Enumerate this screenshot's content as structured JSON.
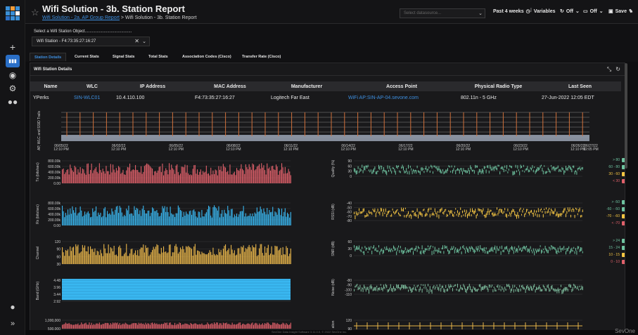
{
  "app": {
    "title": "Wifi Solution - 3b. Station Report",
    "breadcrumb_link": "Wifi Solution - 2a. AP Group Report",
    "breadcrumb_sep": " > ",
    "breadcrumb_current": "Wifi Solution - 3b. Station Report"
  },
  "toolbar": {
    "datasource_placeholder": "Select datasource...",
    "timerange": "Past 4 weeks",
    "variables": "Variables",
    "refresh": "Off",
    "display": "Off",
    "save": "Save"
  },
  "variable": {
    "label": "Select a Wifi Station Object........................................",
    "value": "Wifi Station - F4:73:35:27:16:27"
  },
  "tabs": [
    "Station Details",
    "Current Stats",
    "Signal Stats",
    "Total Stats",
    "Association Codes (Cisco)",
    "Transfer Rate (Cisco)"
  ],
  "panel": {
    "title": "Wifi Station Details"
  },
  "table": {
    "headers": [
      "Name",
      "WLC",
      "IP Address",
      "MAC Address",
      "Manufacturer",
      "Access Point",
      "Physical Radio Type",
      "Last Seen"
    ],
    "row": [
      "YPerks",
      "SIN-WLC01",
      "10.4.110.100",
      "F4:73:35:27:16:27",
      "Logitech Far East",
      "WiFi AP:SIN-AP-04.sevone.com",
      "802.11n - 5 GHz",
      "27-Jun-2022 12:05 EDT"
    ]
  },
  "timeline": {
    "ylabel": "AP, WLC and SSID Trails",
    "ticks": [
      {
        "date": "06/05/22",
        "time": "12:10 PM"
      },
      {
        "date": "06/02/22",
        "time": "12:10 PM"
      },
      {
        "date": "06/05/22",
        "time": "12:10 PM"
      },
      {
        "date": "06/08/22",
        "time": "12:10 PM"
      },
      {
        "date": "06/11/22",
        "time": "12:10 PM"
      },
      {
        "date": "06/14/22",
        "time": "12:10 PM"
      },
      {
        "date": "06/17/22",
        "time": "12:10 PM"
      },
      {
        "date": "06/20/22",
        "time": "12:10 PM"
      },
      {
        "date": "06/23/22",
        "time": "12:10 PM"
      },
      {
        "date": "06/26/22",
        "time": "12:10 PM"
      }
    ],
    "last_tick": {
      "date": "06/27/22",
      "time": "12:05 PM"
    }
  },
  "left_charts": [
    {
      "ylabel": "Tx (bits/sec)",
      "ticks": [
        "800.00k",
        "600.00k",
        "400.00k",
        "200.00k",
        "0.00"
      ],
      "color": "#e0606a",
      "kind": "bars"
    },
    {
      "ylabel": "Rx (bits/sec)",
      "ticks": [
        "800.00k",
        "600.00k",
        "400.00k",
        "200.00k",
        "0.00"
      ],
      "color": "#39b7f0",
      "kind": "bars"
    },
    {
      "ylabel": "Channel",
      "ticks": [
        "120",
        "90",
        "60",
        "30"
      ],
      "color": "#e9b64a",
      "kind": "bars"
    },
    {
      "ylabel": "Band (GHz)",
      "ticks": [
        "4.48",
        "3.96",
        "3.44",
        "2.92"
      ],
      "color": "#39b7f0",
      "kind": "fill"
    },
    {
      "ylabel": "",
      "ticks": [
        "1,000,000",
        "500,000"
      ],
      "color": "#e0606a",
      "kind": "bars"
    }
  ],
  "right_charts": [
    {
      "ylabel": "Quality (%)",
      "ticks": [
        "90",
        "60",
        "30",
        "0"
      ],
      "legend": [
        {
          "label": "> 80",
          "color": "#6ec3a0"
        },
        {
          "label": "60 - 80",
          "color": "#6ec3a0"
        },
        {
          "label": "30 - 60",
          "color": "#f4c542"
        },
        {
          "label": "< 30",
          "color": "#e0606a"
        }
      ]
    },
    {
      "ylabel": "RSSI (dB)",
      "ticks": [
        "-40",
        "-50",
        "-60",
        "-70",
        "-80"
      ],
      "legend": [
        {
          "label": "> -50",
          "color": "#6ec3a0"
        },
        {
          "label": "-60 - -50",
          "color": "#6ec3a0"
        },
        {
          "label": "-70 - -60",
          "color": "#f4c542"
        },
        {
          "label": "< -70",
          "color": "#e0606a"
        }
      ]
    },
    {
      "ylabel": "SNR (dB)",
      "ticks": [
        "60",
        "30",
        "0"
      ],
      "legend": [
        {
          "label": "> 24",
          "color": "#6ec3a0"
        },
        {
          "label": "15 - 24",
          "color": "#6ec3a0"
        },
        {
          "label": "10 - 15",
          "color": "#f4c542"
        },
        {
          "label": "0 - 10",
          "color": "#e0606a"
        }
      ]
    },
    {
      "ylabel": "Noise (dB)",
      "ticks": [
        "-80",
        "-90",
        "-100",
        "-110"
      ],
      "legend": []
    },
    {
      "ylabel": "ation",
      "ticks": [
        "120",
        "90"
      ],
      "legend": []
    }
  ],
  "footer": {
    "text": "SevOne Data Insight Software 3.11.0.0, © 2022 SevOne Inc.",
    "brand": "SevOne"
  }
}
